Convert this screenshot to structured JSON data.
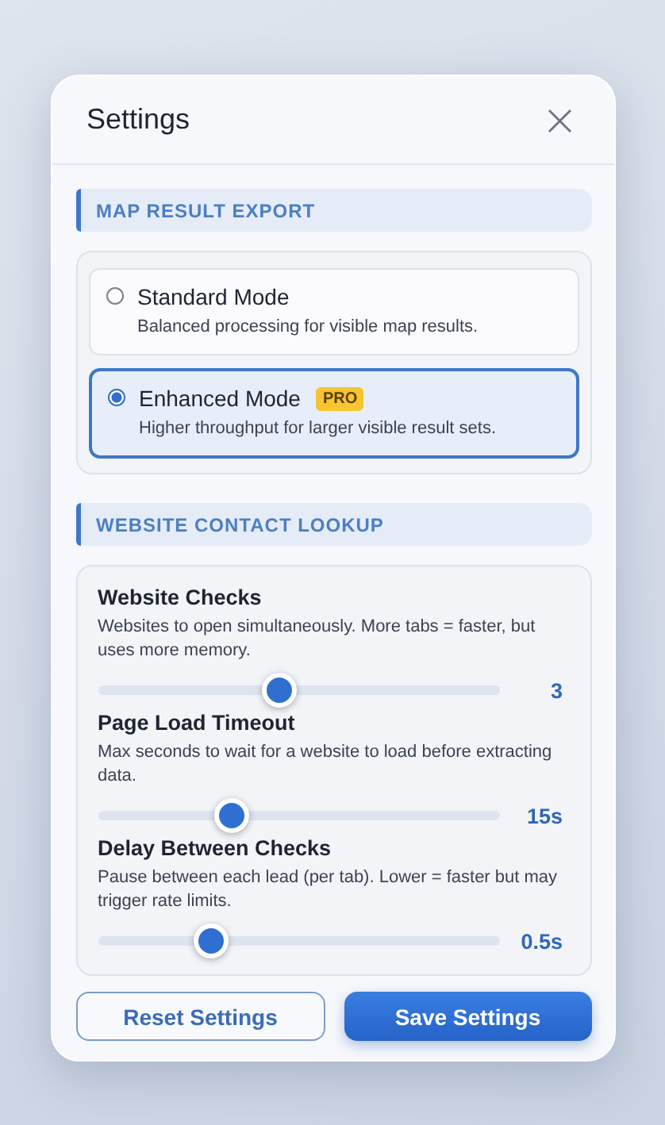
{
  "dialog": {
    "title": "Settings",
    "close": "×"
  },
  "sections": [
    {
      "heading": "MAP RESULT EXPORT",
      "kind": "modes",
      "options": [
        {
          "title": "Standard Mode",
          "description": "Balanced processing for visible map results.",
          "selected": false
        },
        {
          "title": "Enhanced Mode",
          "badge": "PRO",
          "description": "Higher throughput for larger visible result sets.",
          "selected": true
        }
      ]
    },
    {
      "heading": "WEBSITE CONTACT LOOKUP",
      "kind": "sliders",
      "sliders": [
        {
          "label": "Website Checks",
          "description": "Websites to open simultaneously. More tabs = faster, but uses more memory.",
          "level": 0.45,
          "reading": "3"
        },
        {
          "label": "Page Load Timeout",
          "description": "Max seconds to wait for a website to load before extracting data.",
          "level": 0.32,
          "reading": "15s"
        },
        {
          "label": "Delay Between Checks",
          "description": "Pause between each lead (per tab). Lower = faster but may trigger rate limits.",
          "level": 0.26,
          "reading": "0.5s"
        }
      ]
    }
  ],
  "buttons": [
    {
      "label": "Reset Settings",
      "kind": "secondary"
    },
    {
      "label": "Save Settings",
      "kind": "primary"
    }
  ]
}
